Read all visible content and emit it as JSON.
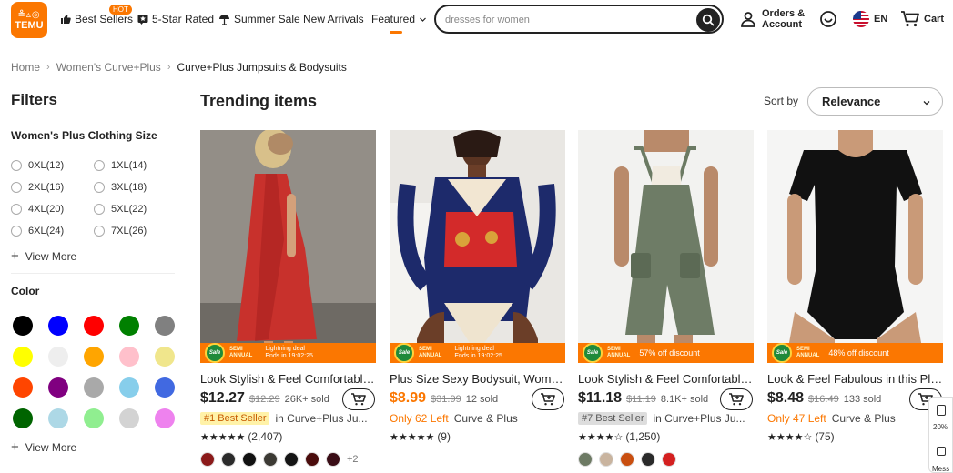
{
  "header": {
    "logo_top": "≗▵◎",
    "logo_bottom": "TEMU",
    "nav": [
      {
        "label": "Best Sellers",
        "icon": "thumbs-up-icon"
      },
      {
        "label": "5-Star Rated",
        "icon": "star-tag-icon"
      },
      {
        "label": "Summer Sale",
        "icon": "parasol-icon"
      },
      {
        "label": "New Arrivals"
      },
      {
        "label": "Featured",
        "icon": "chevron-down-icon"
      }
    ],
    "hot_badge": "HOT",
    "search_value": "dresses for women",
    "orders_line1": "Orders &",
    "orders_line2": "Account",
    "language": "EN",
    "cart_label": "Cart"
  },
  "breadcrumb": [
    "Home",
    "Women's Curve+Plus",
    "Curve+Plus Jumpsuits & Bodysuits"
  ],
  "filters": {
    "title": "Filters",
    "size_title": "Women's Plus Clothing Size",
    "sizes": [
      "0XL(12)",
      "1XL(14)",
      "2XL(16)",
      "3XL(18)",
      "4XL(20)",
      "5XL(22)",
      "6XL(24)",
      "7XL(26)"
    ],
    "view_more": "View More",
    "color_title": "Color",
    "colors": [
      "#000000",
      "#0000ff",
      "#ff0000",
      "#008000",
      "#808080",
      "#ffff00",
      "#eeeeee",
      "#ffa500",
      "#ffc0cb",
      "#f0e68c",
      "#ff4500",
      "#800080",
      "#a9a9a9",
      "#87ceeb",
      "#4169e1",
      "#006400",
      "#add8e6",
      "#90ee90",
      "#d3d3d3",
      "#ee82ee"
    ]
  },
  "main": {
    "title": "Trending items",
    "sort_label": "Sort by",
    "sort_value": "Relevance"
  },
  "products": [
    {
      "title": "Look Stylish & Feel Comfortable in this...",
      "price": "$12.27",
      "old_price": "$12.29",
      "sold": "26K+ sold",
      "badge": "#1 Best Seller",
      "category": "in Curve+Plus Ju...",
      "rating": "★★★★★",
      "reviews": "(2,407)",
      "promo_a": "SEMI",
      "promo_b": "ANNUAL",
      "promo_c": "Lightning deal",
      "promo_d": "Ends in 19:02:25",
      "colors": [
        "#8b1a1a",
        "#2b2b2b",
        "#111111",
        "#3c3a34",
        "#151515",
        "#4a0c0c",
        "#3a0d16"
      ],
      "more": "+2"
    },
    {
      "title": "Plus Size Sexy Bodysuit, Women's Plus...",
      "price": "$8.99",
      "old_price": "$31.99",
      "sold": "12 sold",
      "left": "Only 62 Left",
      "category": "Curve & Plus",
      "rating": "★★★★★",
      "reviews": "(9)",
      "promo_a": "SEMI",
      "promo_b": "ANNUAL",
      "promo_c": "Lightning deal",
      "promo_d": "Ends in 19:02:25"
    },
    {
      "title": "Look Stylish & Feel Comfortable in this...",
      "price": "$11.18",
      "old_price": "$11.19",
      "sold": "8.1K+ sold",
      "badge": "#7 Best Seller",
      "category": "in Curve+Plus Ju...",
      "rating": "★★★★☆",
      "reviews": "(1,250)",
      "promo_a": "SEMI",
      "promo_b": "ANNUAL",
      "promo_c": "57% off discount",
      "colors": [
        "#6d7a64",
        "#c9b49f",
        "#c94f10",
        "#2a2a2a",
        "#d42020"
      ]
    },
    {
      "title": "Look & Feel Fabulous in this Plus Size...",
      "price": "$8.48",
      "old_price": "$16.49",
      "sold": "133 sold",
      "left": "Only 47 Left",
      "category": "Curve & Plus",
      "rating": "★★★★☆",
      "reviews": "(75)",
      "promo_a": "SEMI",
      "promo_b": "ANNUAL",
      "promo_c": "48% off discount"
    }
  ],
  "side_float": {
    "discount": "20%",
    "label": "Mess"
  }
}
